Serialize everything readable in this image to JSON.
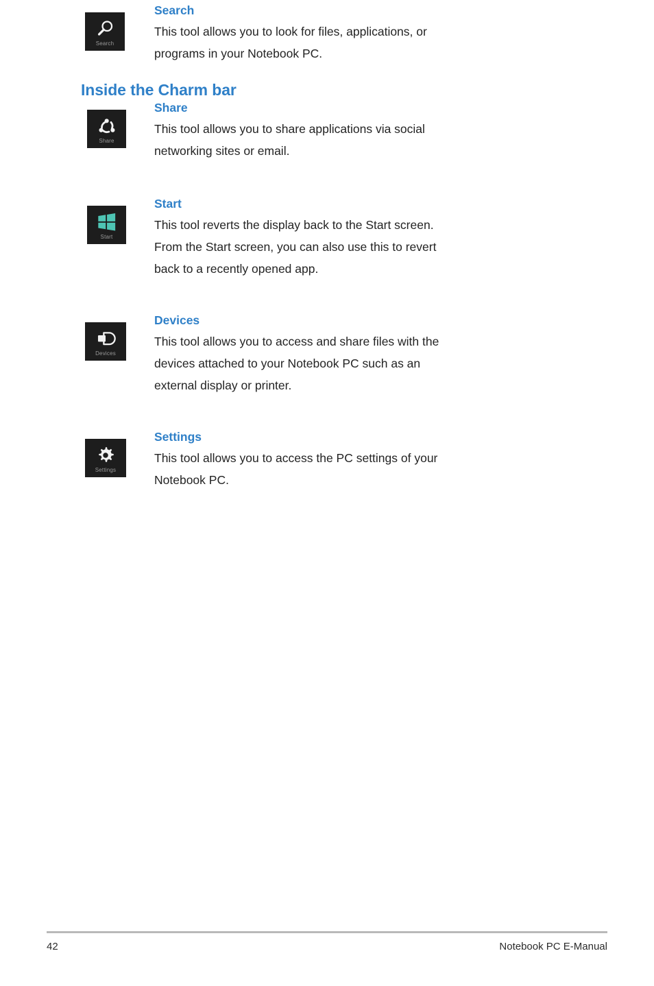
{
  "page": {
    "heading": "Inside the Charm bar",
    "accent_color": "#2f80c8",
    "text_color": "#242424",
    "tile_background": "#1d1d1d",
    "start_icon_color": "#4ec5b4"
  },
  "charms": [
    {
      "icon": "search-icon",
      "tile_label": "Search",
      "title": "Search",
      "lines": [
        "This tool allows you to look for files, applications, or",
        "programs in your Notebook PC."
      ]
    },
    {
      "icon": "share-icon",
      "tile_label": "Share",
      "title": "Share",
      "lines": [
        "This tool allows you to share applications via social",
        "networking sites or email."
      ]
    },
    {
      "icon": "windows-start-icon",
      "tile_label": "Start",
      "title": "Start",
      "lines": [
        "This tool reverts the display back to the Start screen.",
        "From the Start screen, you can also use this to revert",
        "back to a recently opened app."
      ]
    },
    {
      "icon": "devices-icon",
      "tile_label": "Devices",
      "title": "Devices",
      "lines": [
        "This tool allows you to access and share files with the",
        "devices attached to your Notebook PC such as an",
        "external display or printer."
      ]
    },
    {
      "icon": "gear-icon",
      "tile_label": "Settings",
      "title": "Settings",
      "lines": [
        "This tool allows you to access the PC settings of your",
        "Notebook PC."
      ]
    }
  ],
  "footer": {
    "page_number": "42",
    "document_title": "Notebook PC E-Manual"
  }
}
